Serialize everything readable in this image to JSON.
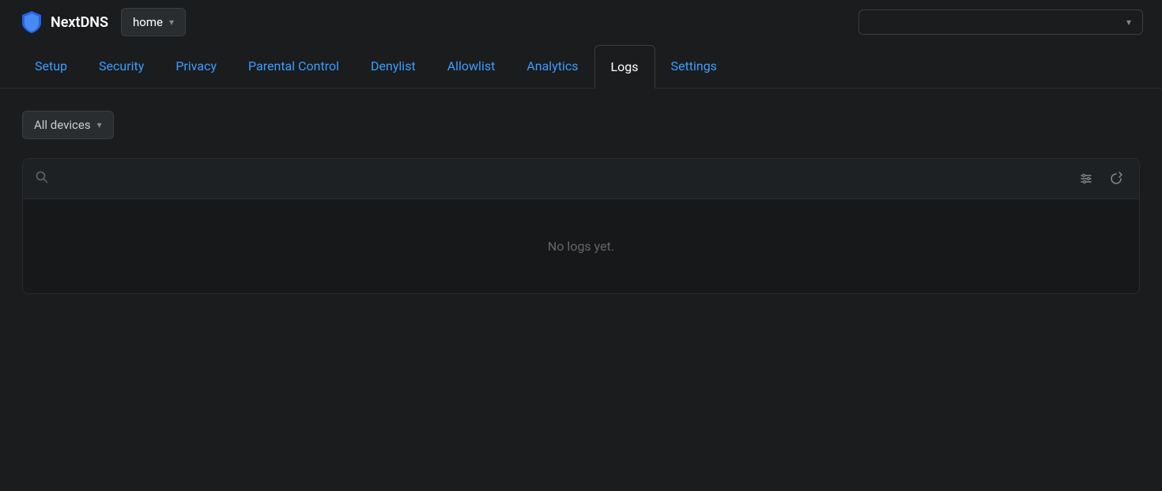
{
  "header": {
    "logo_text": "NextDNS",
    "profile_label": "home",
    "account_placeholder": ""
  },
  "nav": {
    "items": [
      {
        "label": "Setup",
        "active": false
      },
      {
        "label": "Security",
        "active": false
      },
      {
        "label": "Privacy",
        "active": false
      },
      {
        "label": "Parental Control",
        "active": false
      },
      {
        "label": "Denylist",
        "active": false
      },
      {
        "label": "Allowlist",
        "active": false
      },
      {
        "label": "Analytics",
        "active": false
      },
      {
        "label": "Logs",
        "active": true
      },
      {
        "label": "Settings",
        "active": false
      }
    ]
  },
  "main": {
    "devices_label": "All devices",
    "search_placeholder": "",
    "empty_message": "No logs yet."
  },
  "icons": {
    "chevron": "▾",
    "search": "🔍",
    "filter": "⚙",
    "refresh": "↻"
  }
}
